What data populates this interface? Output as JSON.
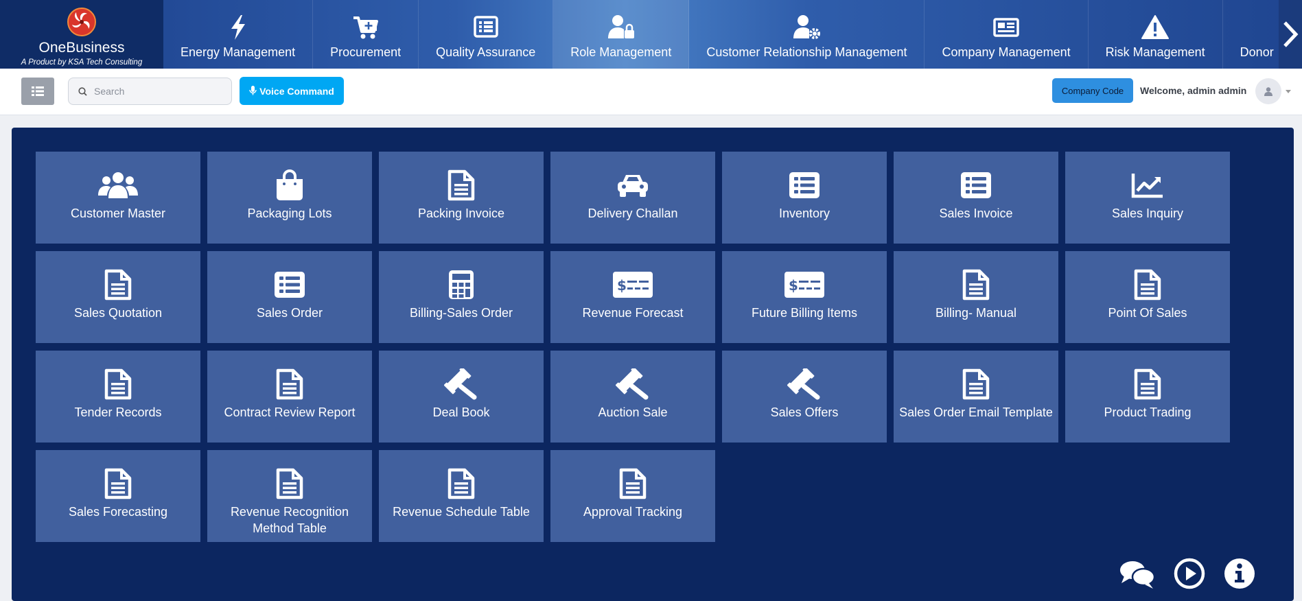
{
  "brand": {
    "name": "OneBusiness",
    "tagline": "A Product by KSA Tech Consulting"
  },
  "nav": [
    {
      "label": "Energy Management",
      "icon": "bolt-icon"
    },
    {
      "label": "Procurement",
      "icon": "cart-plus-icon"
    },
    {
      "label": "Quality Assurance",
      "icon": "list-alt-icon"
    },
    {
      "label": "Role Management",
      "icon": "user-lock-icon"
    },
    {
      "label": "Customer Relationship Management",
      "icon": "user-gear-icon"
    },
    {
      "label": "Company Management",
      "icon": "newspaper-icon"
    },
    {
      "label": "Risk Management",
      "icon": "warning-icon"
    },
    {
      "label": "Donor",
      "icon": ""
    }
  ],
  "toolbar": {
    "search_placeholder": "Search",
    "voice_label": "Voice Command",
    "company_label": "Company Code",
    "welcome": "Welcome, admin admin"
  },
  "tiles": [
    {
      "label": "Customer Master",
      "icon": "users-icon"
    },
    {
      "label": "Packaging Lots",
      "icon": "shopping-bag-icon"
    },
    {
      "label": "Packing Invoice",
      "icon": "document-icon"
    },
    {
      "label": "Delivery Challan",
      "icon": "car-icon"
    },
    {
      "label": "Inventory",
      "icon": "list-alt-icon"
    },
    {
      "label": "Sales Invoice",
      "icon": "list-alt-icon"
    },
    {
      "label": "Sales Inquiry",
      "icon": "line-chart-icon"
    },
    {
      "label": "Sales Quotation",
      "icon": "document-icon"
    },
    {
      "label": "Sales Order",
      "icon": "list-alt-icon"
    },
    {
      "label": "Billing-Sales Order",
      "icon": "calculator-icon"
    },
    {
      "label": "Revenue Forecast",
      "icon": "money-check-icon"
    },
    {
      "label": "Future Billing Items",
      "icon": "money-check-icon"
    },
    {
      "label": "Billing- Manual",
      "icon": "document-icon"
    },
    {
      "label": "Point Of Sales",
      "icon": "document-icon"
    },
    {
      "label": "Tender Records",
      "icon": "document-icon"
    },
    {
      "label": "Contract Review Report",
      "icon": "document-icon"
    },
    {
      "label": "Deal Book",
      "icon": "gavel-icon"
    },
    {
      "label": "Auction Sale",
      "icon": "gavel-icon"
    },
    {
      "label": "Sales Offers",
      "icon": "gavel-icon"
    },
    {
      "label": "Sales Order Email Template",
      "icon": "document-icon"
    },
    {
      "label": "Product Trading",
      "icon": "document-icon"
    },
    {
      "label": "Sales Forecasting",
      "icon": "document-icon"
    },
    {
      "label": "Revenue Recognition Method Table",
      "icon": "document-icon"
    },
    {
      "label": "Revenue Schedule Table",
      "icon": "document-icon"
    },
    {
      "label": "Approval Tracking",
      "icon": "document-icon"
    }
  ],
  "colors": {
    "nav_dark": "#0f2c66",
    "panel": "#0c2660",
    "tile": "#41609e",
    "voice": "#00a7f3",
    "company": "#2e8fe0"
  }
}
